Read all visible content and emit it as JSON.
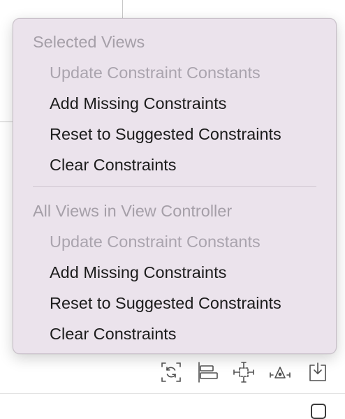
{
  "menu": {
    "sections": [
      {
        "header": "Selected Views",
        "items": [
          {
            "label": "Update Constraint Constants",
            "enabled": false
          },
          {
            "label": "Add Missing Constraints",
            "enabled": true
          },
          {
            "label": "Reset to Suggested Constraints",
            "enabled": true
          },
          {
            "label": "Clear Constraints",
            "enabled": true
          }
        ]
      },
      {
        "header": "All Views in View Controller",
        "items": [
          {
            "label": "Update Constraint Constants",
            "enabled": false
          },
          {
            "label": "Add Missing Constraints",
            "enabled": true
          },
          {
            "label": "Reset to Suggested Constraints",
            "enabled": true
          },
          {
            "label": "Clear Constraints",
            "enabled": true
          }
        ]
      }
    ]
  },
  "toolbar": {
    "icons": [
      "update-frames-icon",
      "align-icon",
      "add-new-constraints-icon",
      "resolve-auto-layout-issues-icon",
      "embed-in-icon"
    ]
  },
  "colors": {
    "menu_background": "#ebe3ec",
    "enabled_text": "#1c1c1c",
    "disabled_text": "#aaa4ae"
  }
}
